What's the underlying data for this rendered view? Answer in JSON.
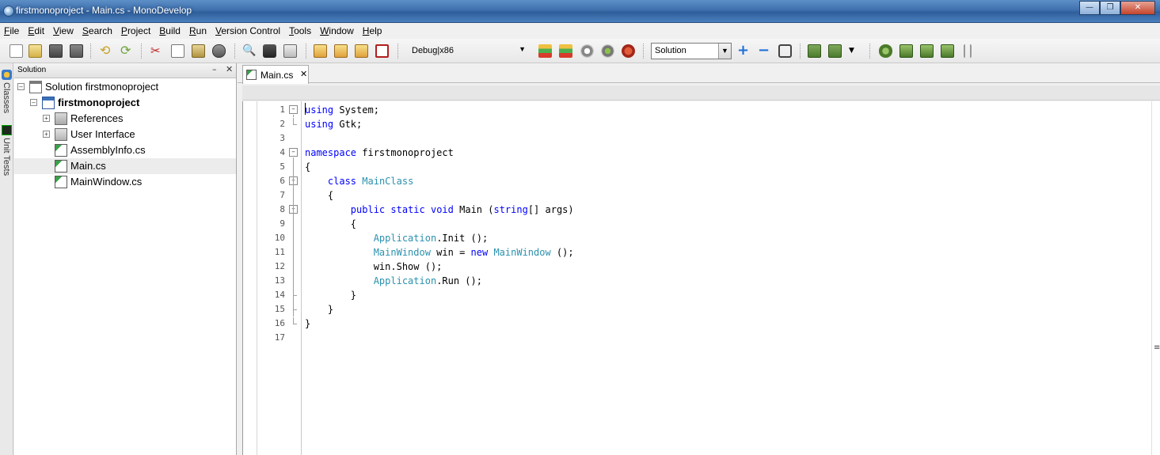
{
  "window": {
    "title": "firstmonoproject - Main.cs - MonoDevelop",
    "minimize": "—",
    "maximize": "❐",
    "close": "✕"
  },
  "menu": [
    "File",
    "Edit",
    "View",
    "Search",
    "Project",
    "Build",
    "Run",
    "Version Control",
    "Tools",
    "Window",
    "Help"
  ],
  "toolbar": {
    "configuration": "Debug|x86",
    "scope": "Solution",
    "combo_arrow": "▼"
  },
  "side_tabs": {
    "classes": "Classes",
    "unit_tests": "Unit Tests"
  },
  "solution_pad": {
    "title": "Solution",
    "minimize": "–",
    "close": "✕",
    "tree": [
      {
        "label": "Solution firstmonoproject",
        "expander": "–",
        "icon": "solution-icon"
      },
      {
        "label": "firstmonoproject",
        "expander": "–",
        "icon": "project-icon",
        "bold": true
      },
      {
        "label": "References",
        "expander": "+",
        "icon": "references-folder-icon"
      },
      {
        "label": "User Interface",
        "expander": "+",
        "icon": "folder-icon"
      },
      {
        "label": "AssemblyInfo.cs",
        "icon": "csharp-file-icon"
      },
      {
        "label": "Main.cs",
        "icon": "csharp-file-icon",
        "selected": true
      },
      {
        "label": "MainWindow.cs",
        "icon": "csharp-file-icon"
      }
    ]
  },
  "editor": {
    "tab_label": "Main.cs",
    "tab_close": "✕",
    "fold_symbol": "–",
    "line_numbers": [
      "1",
      "2",
      "3",
      "4",
      "5",
      "6",
      "7",
      "8",
      "9",
      "10",
      "11",
      "12",
      "13",
      "14",
      "15",
      "16",
      "17"
    ],
    "code_lines": [
      [
        {
          "t": "using",
          "c": "kw"
        },
        {
          "t": " System;"
        }
      ],
      [
        {
          "t": "using",
          "c": "kw"
        },
        {
          "t": " Gtk;"
        }
      ],
      [],
      [
        {
          "t": "namespace",
          "c": "kw"
        },
        {
          "t": " firstmonoproject"
        }
      ],
      [
        {
          "t": "{"
        }
      ],
      [
        {
          "t": "    "
        },
        {
          "t": "class",
          "c": "kw"
        },
        {
          "t": " "
        },
        {
          "t": "MainClass",
          "c": "ty"
        }
      ],
      [
        {
          "t": "    {"
        }
      ],
      [
        {
          "t": "        "
        },
        {
          "t": "public",
          "c": "kw"
        },
        {
          "t": " "
        },
        {
          "t": "static",
          "c": "kw"
        },
        {
          "t": " "
        },
        {
          "t": "void",
          "c": "kw"
        },
        {
          "t": " Main ("
        },
        {
          "t": "string",
          "c": "kw"
        },
        {
          "t": "[] args)"
        }
      ],
      [
        {
          "t": "        {"
        }
      ],
      [
        {
          "t": "            "
        },
        {
          "t": "Application",
          "c": "ty"
        },
        {
          "t": ".Init ();"
        }
      ],
      [
        {
          "t": "            "
        },
        {
          "t": "MainWindow",
          "c": "ty"
        },
        {
          "t": " win = "
        },
        {
          "t": "new",
          "c": "kw"
        },
        {
          "t": " "
        },
        {
          "t": "MainWindow",
          "c": "ty"
        },
        {
          "t": " ();"
        }
      ],
      [
        {
          "t": "            win.Show ();"
        }
      ],
      [
        {
          "t": "            "
        },
        {
          "t": "Application",
          "c": "ty"
        },
        {
          "t": ".Run ();"
        }
      ],
      [
        {
          "t": "        }"
        }
      ],
      [
        {
          "t": "    }"
        }
      ],
      [
        {
          "t": "}"
        }
      ],
      []
    ],
    "scroll_grip": "≡"
  }
}
